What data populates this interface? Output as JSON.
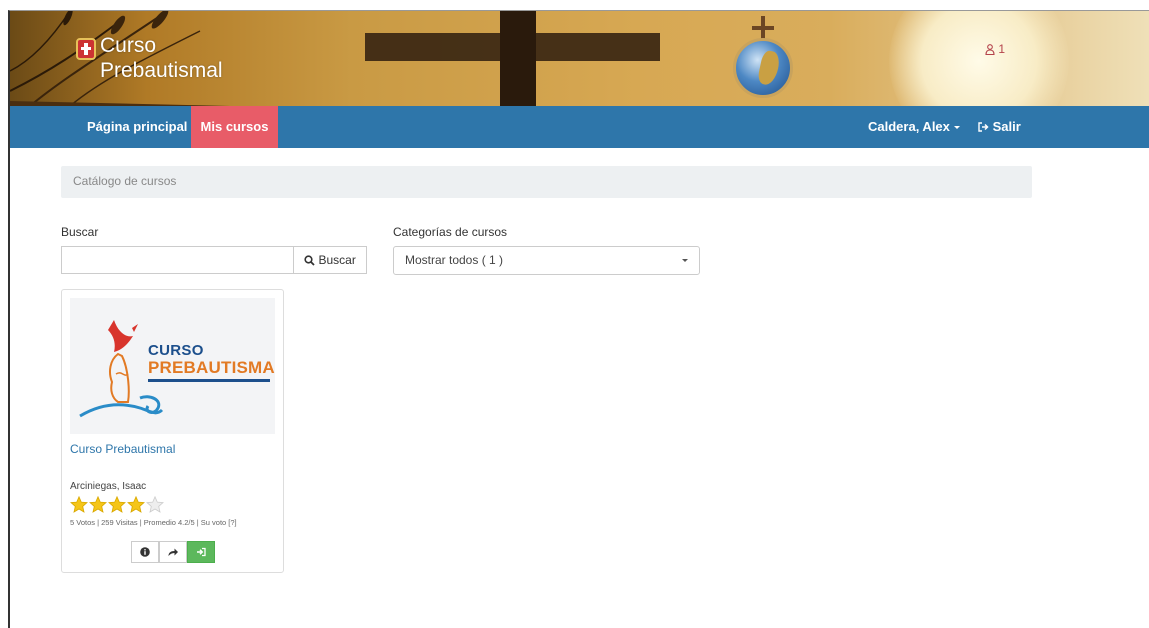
{
  "header": {
    "brand_line1": "Curso",
    "brand_line2": "Prebautismal",
    "notifications_count": "1"
  },
  "nav": {
    "home": "Página principal",
    "my_courses": "Mis cursos",
    "user": "Caldera, Alex",
    "logout": "Salir"
  },
  "breadcrumb": "Catálogo de cursos",
  "search": {
    "label": "Buscar",
    "value": "",
    "button": "Buscar"
  },
  "categories": {
    "label": "Categorías de cursos",
    "selected": "Mostrar todos ( 1 )"
  },
  "courses": [
    {
      "image_line1": "CURSO",
      "image_line2": "PREBAUTISMAL",
      "title": "Curso Prebautismal",
      "author": "Arciniegas, Isaac",
      "rating": 4.2,
      "rating_max": 5,
      "stats": "5 Votos | 259 Visitas | Promedio 4.2/5 | Su voto [?]"
    }
  ],
  "colors": {
    "navbar": "#2e76aa",
    "active_nav": "#e85c68",
    "star": "#f5c518",
    "enter_button": "#5cb85c"
  },
  "icons": [
    "user-icon",
    "logout-icon",
    "search-icon",
    "info-icon",
    "share-icon",
    "sign-in-icon",
    "star-icon"
  ]
}
